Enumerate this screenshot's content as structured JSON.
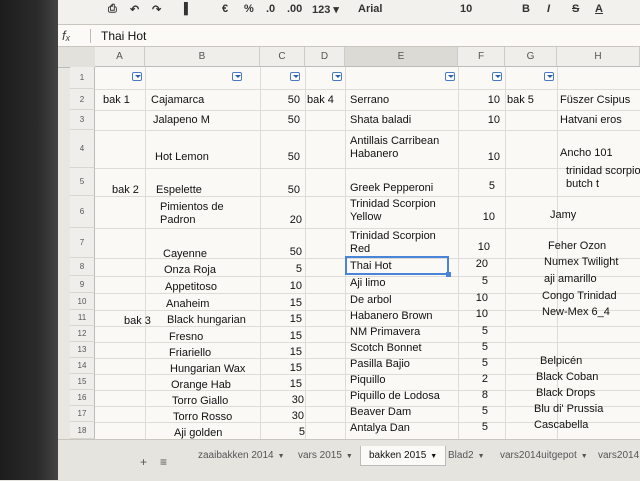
{
  "toolbar": {
    "items": [
      {
        "name": "print-icon",
        "label": "⎙"
      },
      {
        "name": "undo-icon",
        "label": "↶"
      },
      {
        "name": "redo-icon",
        "label": "↷"
      },
      {
        "name": "paint-format-icon",
        "label": "▐"
      },
      {
        "name": "currency-button",
        "label": "€"
      },
      {
        "name": "percent-button",
        "label": "%"
      },
      {
        "name": "decrease-decimals-button",
        "label": ".0"
      },
      {
        "name": "increase-decimals-button",
        "label": ".00"
      },
      {
        "name": "number-format-button",
        "label": "123 ▾"
      },
      {
        "name": "font-family-select",
        "label": "Arial"
      },
      {
        "name": "font-size-select",
        "label": "10"
      },
      {
        "name": "bold-button",
        "label": "B"
      },
      {
        "name": "italic-button",
        "label": "I"
      },
      {
        "name": "strikethrough-button",
        "label": "S"
      },
      {
        "name": "text-color-button",
        "label": "A"
      }
    ]
  },
  "formula_bar": {
    "fx": "fₓ",
    "value": "Thai Hot"
  },
  "column_headers": [
    "A",
    "B",
    "C",
    "D",
    "E",
    "F",
    "G",
    "H"
  ],
  "row_headers": [
    "1",
    "2",
    "3",
    "4",
    "5",
    "6",
    "7",
    "8",
    "9",
    "10",
    "11",
    "12",
    "13",
    "14",
    "15",
    "16",
    "17",
    "18"
  ],
  "cells": {
    "r2": {
      "a": "bak 1",
      "b": "Cajamarca",
      "c": "50",
      "d": "bak 4",
      "e": "Serrano",
      "f": "10",
      "g": "bak 5",
      "h": "Füszer Csipus"
    },
    "r3": {
      "b": "Jalapeno M",
      "c": "50",
      "e": "Shata baladi",
      "f": "10",
      "h": "Hatvani eros"
    },
    "r4": {
      "b": "Hot Lemon",
      "c": "50",
      "e1": "Antillais Carribean",
      "e2": "Habanero",
      "f": "10",
      "h": "Ancho 101"
    },
    "r5": {
      "a": "bak 2",
      "b": "Espelette",
      "c": "50",
      "e": "Greek Pepperoni",
      "f": "5",
      "h1": "trinidad scorpion",
      "h2": "butch t"
    },
    "r6": {
      "b1": "Pimientos de",
      "b2": "Padron",
      "c": "20",
      "e1": "Trinidad Scorpion",
      "e2": "Yellow",
      "f": "10",
      "h": "Jamy"
    },
    "r7": {
      "b": "Cayenne",
      "c": "50",
      "e1": "Trinidad Scorpion",
      "e2": "Red",
      "f": "10",
      "h": "Feher Ozon"
    },
    "r8": {
      "b": "Onza Roja",
      "c": "5",
      "e": "Thai Hot",
      "f": "20",
      "h": "Numex Twilight"
    },
    "r9": {
      "b": "Appetitoso",
      "c": "10",
      "e": "Aji limo",
      "f": "5",
      "h": "aji amarillo"
    },
    "r10": {
      "b": "Anaheim",
      "c": "15",
      "e": "De arbol",
      "f": "10",
      "h": "Congo Trinidad"
    },
    "r11": {
      "a": "bak 3",
      "b": "Black hungarian",
      "c": "15",
      "e": "Habanero Brown",
      "f": "10",
      "h": "New-Mex 6_4"
    },
    "r12": {
      "b": "Fresno",
      "c": "15",
      "e": "NM Primavera",
      "f": "5"
    },
    "r13": {
      "b": "Friariello",
      "c": "15",
      "e": "Scotch Bonnet",
      "f": "5"
    },
    "r14": {
      "b": "Hungarian Wax",
      "c": "15",
      "e": "Pasilla Bajio",
      "f": "5",
      "h": "Belpicén"
    },
    "r15": {
      "b": "Orange Hab",
      "c": "15",
      "e": "Piquillo",
      "f": "2",
      "h": "Black Coban"
    },
    "r16": {
      "b": "Torro Giallo",
      "c": "30",
      "e": "Piquillo de Lodosa",
      "f": "8",
      "h": "Black Drops"
    },
    "r17": {
      "b": "Torro Rosso",
      "c": "30",
      "e": "Beaver Dam",
      "f": "5",
      "h": "Blu di' Prussia"
    },
    "r18": {
      "b": "Aji golden",
      "c": "5",
      "e": "Antalya Dan",
      "f": "5",
      "h": "Cascabella"
    }
  },
  "sheet_tabs": {
    "add": "+",
    "list": "≡",
    "tabs": [
      "zaaibakken 2014",
      "vars 2015",
      "bakken 2015",
      "Blad2",
      "vars2014uitgepot",
      "vars2014"
    ],
    "active": "bakken 2015"
  }
}
